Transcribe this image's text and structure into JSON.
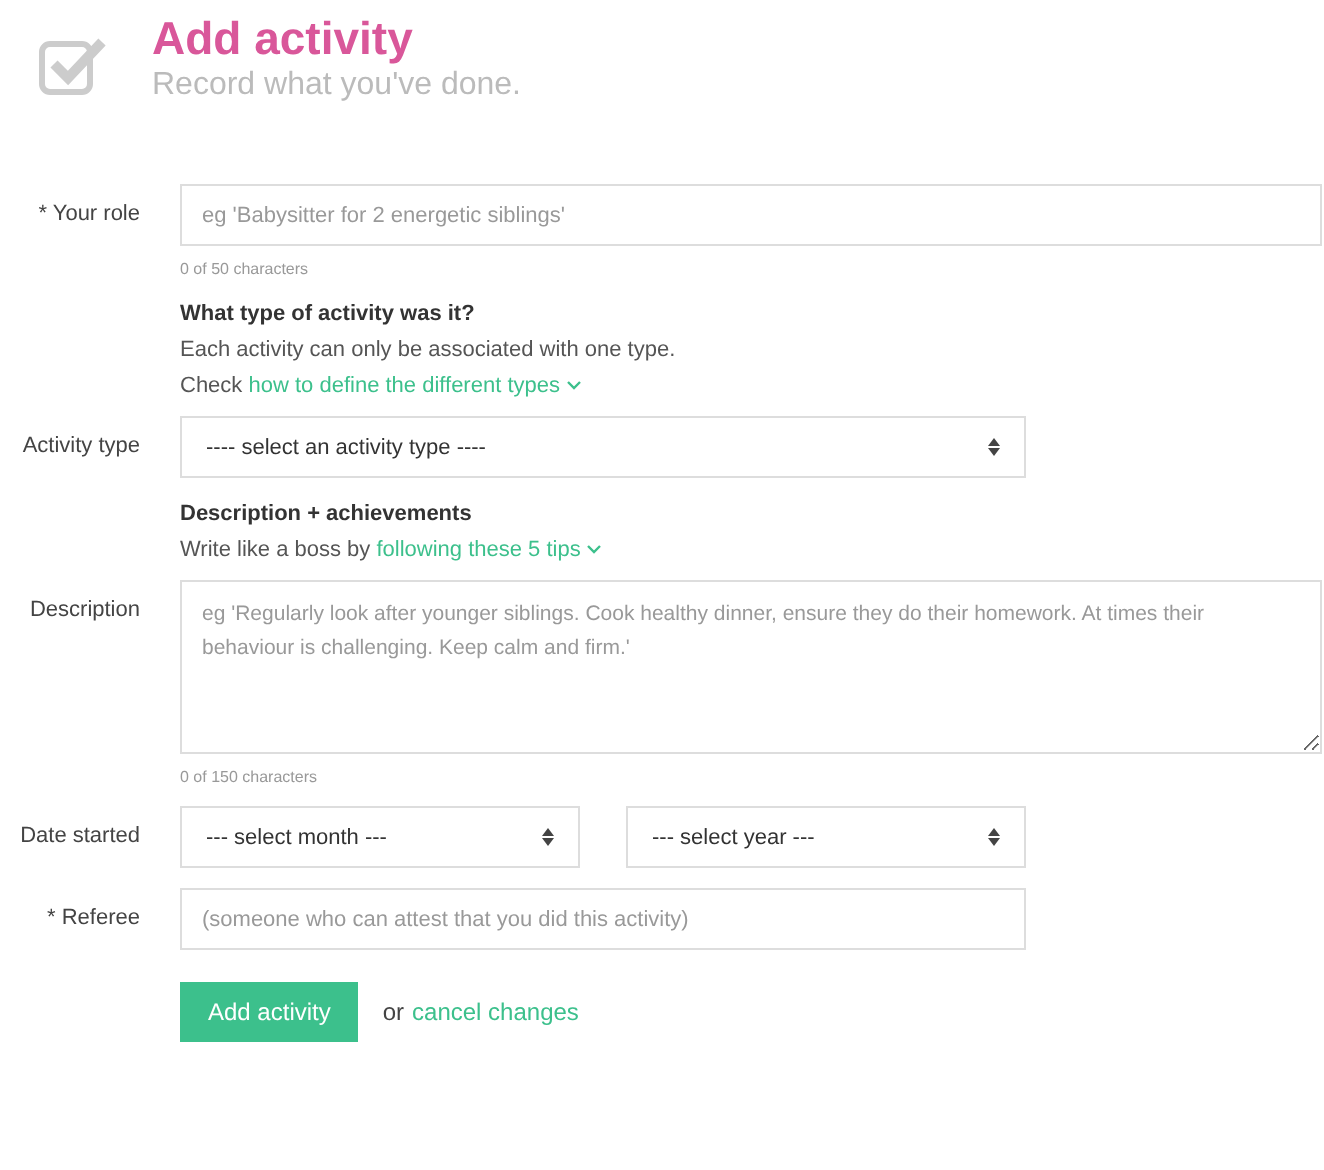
{
  "header": {
    "title": "Add activity",
    "subtitle": "Record what you've done."
  },
  "fields": [
    {
      "kind": "input",
      "label": "* Your role",
      "placeholder": "eg 'Babysitter for 2 energetic siblings'",
      "counter": "0 of 50 characters",
      "wide": true
    },
    {
      "kind": "intro",
      "heading": "What type of activity was it?",
      "lines": [
        {
          "text": "Each activity can only be associated with one type."
        },
        {
          "text": "Check ",
          "link": "how to define the different types"
        }
      ]
    },
    {
      "kind": "select",
      "label": "Activity type",
      "options": [
        "---- select an activity type ----"
      ]
    },
    {
      "kind": "intro",
      "heading": "Description + achievements",
      "lines": [
        {
          "text": "Write like a boss by ",
          "link": "following these 5 tips"
        }
      ]
    },
    {
      "kind": "textarea",
      "label": "Description",
      "placeholder": "eg 'Regularly look after younger siblings. Cook healthy dinner, ensure they do their homework. At times their behaviour is challenging. Keep calm and firm.'",
      "counter": "0 of 150 characters"
    },
    {
      "kind": "select",
      "label": "Date started",
      "options": [
        "--- select month ---",
        "--- select year ---"
      ]
    },
    {
      "kind": "input",
      "label": "* Referee",
      "placeholder": "(someone who can attest that you did this activity)",
      "wide": false
    }
  ],
  "actions": {
    "button": "Add activity",
    "or": "or",
    "link": "cancel changes"
  }
}
